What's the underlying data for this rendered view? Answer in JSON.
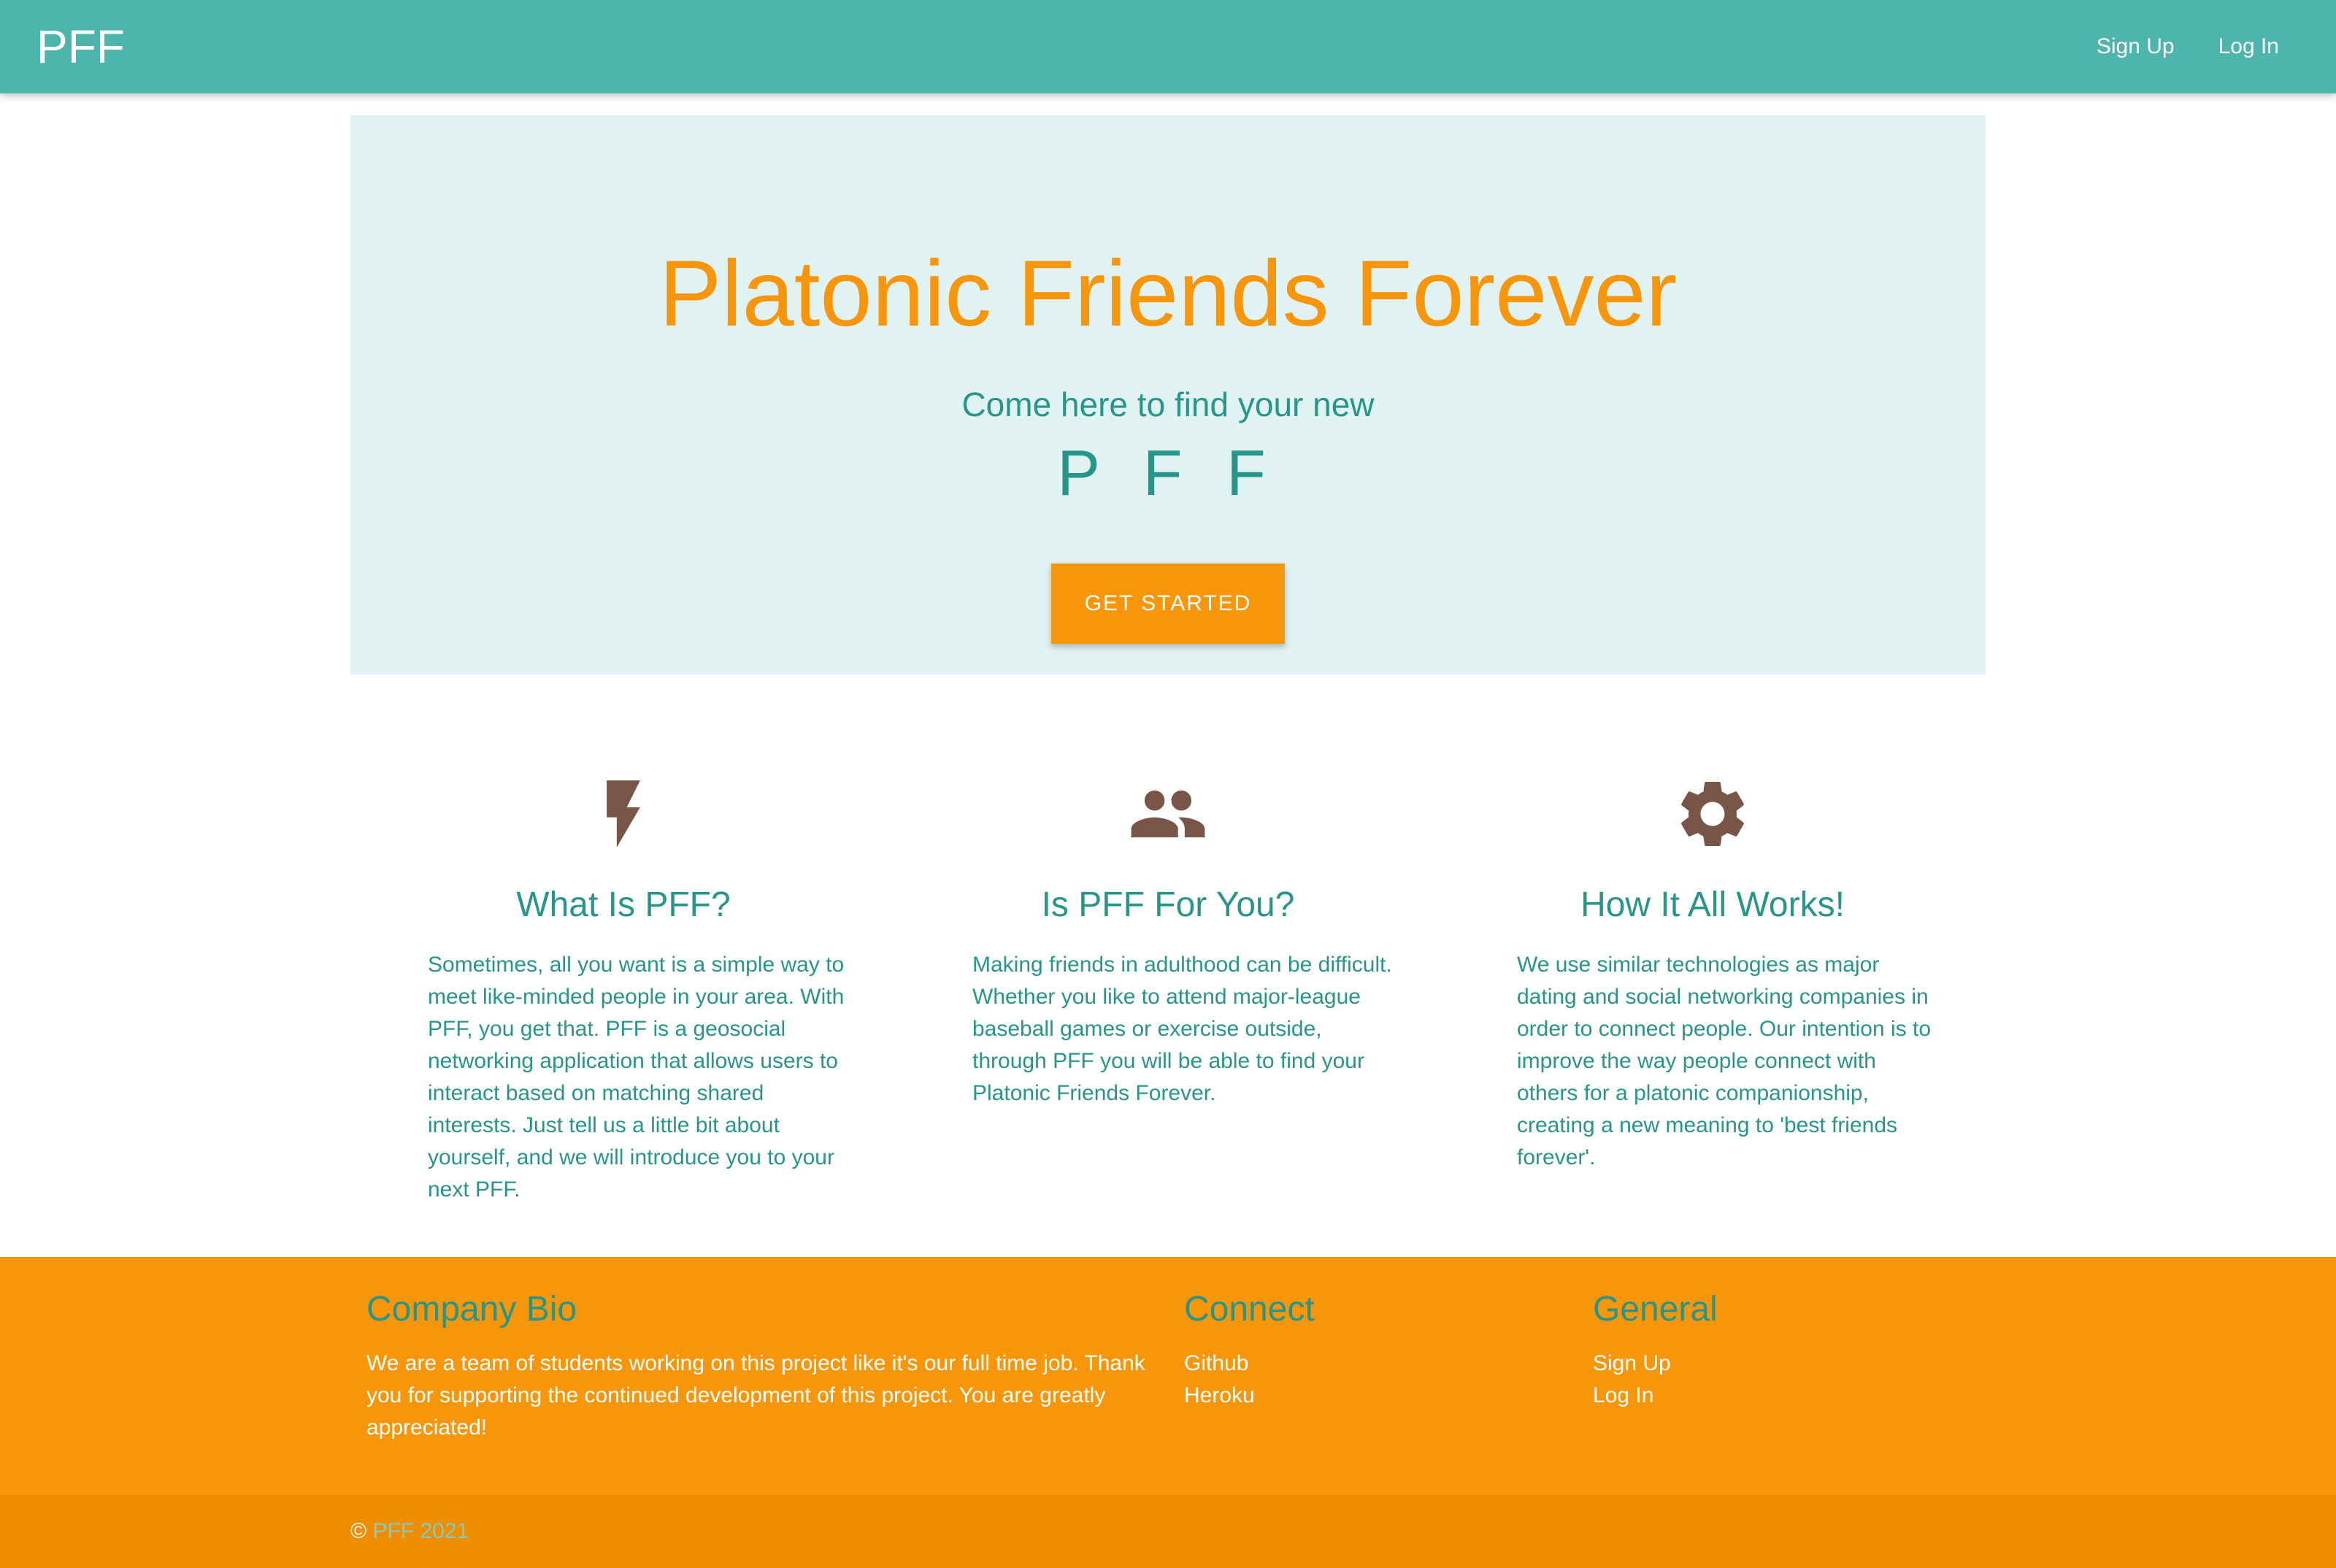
{
  "navbar": {
    "brand": "PFF",
    "links": [
      "Sign Up",
      "Log In"
    ]
  },
  "hero": {
    "title": "Platonic Friends Forever",
    "subtitle": "Come here to find your new",
    "acronym": "P F F",
    "cta_label": "GET STARTED"
  },
  "features": [
    {
      "icon": "flash-icon",
      "title": "What Is PFF?",
      "text": "Sometimes, all you want is a simple way to meet like-minded people in your area. With PFF, you get that. PFF is a geosocial networking application that allows users to interact based on matching shared interests. Just tell us a little bit about yourself, and we will introduce you to your next PFF."
    },
    {
      "icon": "people-icon",
      "title": "Is PFF For You?",
      "text": "Making friends in adulthood can be difficult. Whether you like to attend major-league baseball games or exercise outside, through PFF you will be able to find your Platonic Friends Forever."
    },
    {
      "icon": "gear-icon",
      "title": "How It All Works!",
      "text": "We use similar technologies as major dating and social networking companies in order to connect people. Our intention is to improve the way people connect with others for a platonic companionship, creating a new meaning to 'best friends forever'."
    }
  ],
  "footer": {
    "bio": {
      "heading": "Company Bio",
      "text": "We are a team of students working on this project like it's our full time job. Thank you for supporting the continued development of this project. You are greatly appreciated!"
    },
    "connect": {
      "heading": "Connect",
      "links": [
        "Github",
        "Heroku"
      ]
    },
    "general": {
      "heading": "General",
      "links": [
        "Sign Up",
        "Log In"
      ]
    },
    "copyright_symbol": "©",
    "copyright_name": "PFF 2021"
  },
  "colors": {
    "navbar": "#4db6ac",
    "hero_bg": "#e0f2f1",
    "accent_orange": "#f7960a",
    "teal_text": "#26968a",
    "icon_brown": "#795548",
    "footer_bottom": "#ef8e00"
  }
}
